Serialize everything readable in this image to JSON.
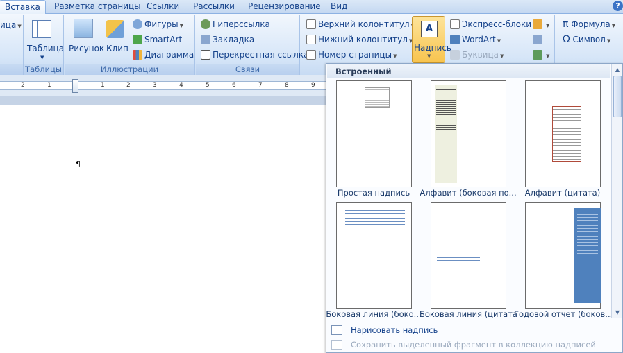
{
  "tabs": [
    "Вставка",
    "Разметка страницы",
    "Ссылки",
    "Рассылки",
    "Рецензирование",
    "Вид"
  ],
  "active_tab": "Вставка",
  "help_label": "?",
  "ribbon": {
    "cut_label": "ица",
    "tables": {
      "table_label": "Таблица",
      "group_label": "Таблицы"
    },
    "illustrations": {
      "picture": "Рисунок",
      "clip": "Клип",
      "shapes": "Фигуры",
      "smartart": "SmartArt",
      "chart": "Диаграмма",
      "group_label": "Иллюстрации"
    },
    "links": {
      "hyperlink": "Гиперссылка",
      "bookmark": "Закладка",
      "cross_ref": "Перекрестная ссылка",
      "group_label": "Связи"
    },
    "header_footer": {
      "header": "Верхний колонтитул",
      "footer": "Нижний колонтитул",
      "page_number": "Номер страницы"
    },
    "text": {
      "textbox": "Надпись",
      "quick_parts": "Экспресс-блоки",
      "wordart": "WordArt",
      "dropcap": "Буквица"
    },
    "symbols": {
      "equation": "Формула",
      "symbol": "Символ"
    }
  },
  "ruler_numbers": [
    "2",
    "1",
    "1",
    "2",
    "3",
    "4",
    "5",
    "6",
    "7",
    "8",
    "9"
  ],
  "document": {
    "cursor_mark": "¶"
  },
  "gallery": {
    "header": "Встроенный",
    "items": [
      {
        "label": "Простая надпись"
      },
      {
        "label": "Алфавит (боковая по..."
      },
      {
        "label": "Алфавит (цитата)"
      },
      {
        "label": "Боковая линия (боко..."
      },
      {
        "label": "Боковая линия (цитата)"
      },
      {
        "label": "Годовой отчет (боков..."
      }
    ],
    "draw_textbox": "Нарисовать надпись",
    "draw_textbox_accel": "Н",
    "draw_textbox_rest": "арисовать надпись",
    "save_selection": "Сохранить выделенный фрагмент в коллекцию надписей"
  },
  "colors": {
    "accent": "#15428b",
    "active_button": "#f8c44f",
    "report_blue": "#4f81bd"
  }
}
